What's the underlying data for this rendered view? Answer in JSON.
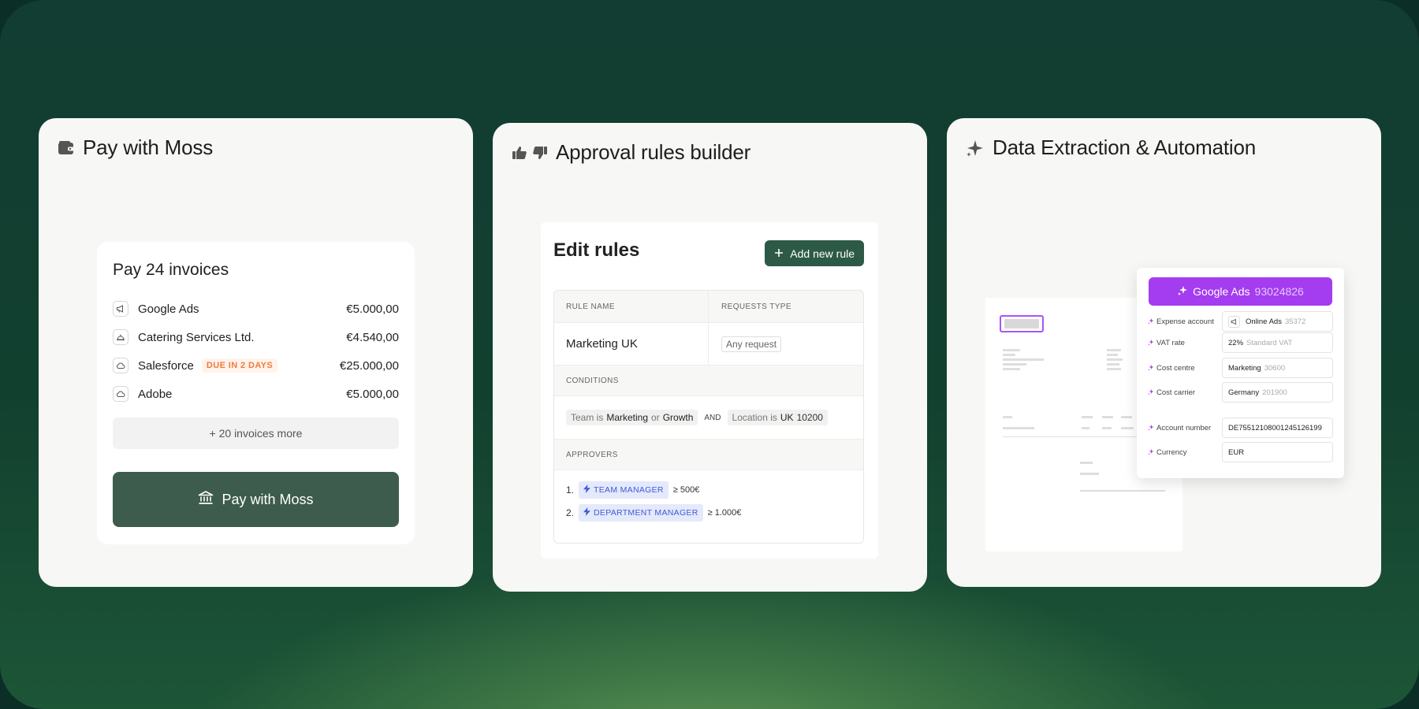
{
  "colors": {
    "moss_green": "#3d5c4d",
    "rule_green": "#2d5a47",
    "due_orange": "#ef7b3e",
    "approver_blue": "#3f5bd6",
    "ai_purple": "#a43cf0"
  },
  "cards": {
    "pay": {
      "title": "Pay with Moss",
      "icon": "wallet-icon",
      "panel_title": "Pay 24 invoices",
      "invoices": [
        {
          "name": "Google Ads",
          "amount": "€5.000,00",
          "icon": "megaphone-icon"
        },
        {
          "name": "Catering Services Ltd.",
          "amount": "€4.540,00",
          "icon": "cloche-icon"
        },
        {
          "name": "Salesforce",
          "amount": "€25.000,00",
          "icon": "cloud-icon",
          "badge": "DUE IN 2 DAYS"
        },
        {
          "name": "Adobe",
          "amount": "€5.000,00",
          "icon": "cloud-icon"
        }
      ],
      "more_label": "+ 20 invoices more",
      "button_label": "Pay with Moss",
      "button_icon": "bank-icon"
    },
    "approval": {
      "title": "Approval rules builder",
      "icons": [
        "thumbs-up-icon",
        "thumbs-down-icon"
      ],
      "panel_title": "Edit rules",
      "add_button": "Add new rule",
      "columns": [
        "RULE NAME",
        "REQUESTS TYPE"
      ],
      "rule_name": "Marketing UK",
      "request_type": "Any request",
      "conditions_label": "CONDITIONS",
      "condition": {
        "team_prefix": "Team is",
        "team_a": "Marketing",
        "or": "or",
        "team_b": "Growth",
        "and": "AND",
        "location_prefix": "Location is",
        "location": "UK",
        "location_code": "10200"
      },
      "approvers_label": "APPROVERS",
      "approvers": [
        {
          "num": "1.",
          "role": "TEAM MANAGER",
          "threshold": "≥ 500€"
        },
        {
          "num": "2.",
          "role": "DEPARTMENT MANAGER",
          "threshold": "≥ 1.000€"
        }
      ]
    },
    "extraction": {
      "title": "Data Extraction & Automation",
      "icon": "sparkle-icon",
      "vendor": "Google Ads",
      "vendor_id": "93024826",
      "fields": [
        {
          "label": "Expense account",
          "value": "Online Ads",
          "muted": "35372",
          "icon": "megaphone-icon"
        },
        {
          "label": "VAT rate",
          "value": "22%",
          "muted": "Standard VAT"
        },
        {
          "label": "Cost centre",
          "value": "Marketing",
          "muted": "30600"
        },
        {
          "label": "Cost carrier",
          "value": "Germany",
          "muted": "201900"
        },
        {
          "label": "Account number",
          "value": "DE75512108001245126199",
          "muted": ""
        },
        {
          "label": "Currency",
          "value": "EUR",
          "muted": ""
        }
      ]
    }
  }
}
